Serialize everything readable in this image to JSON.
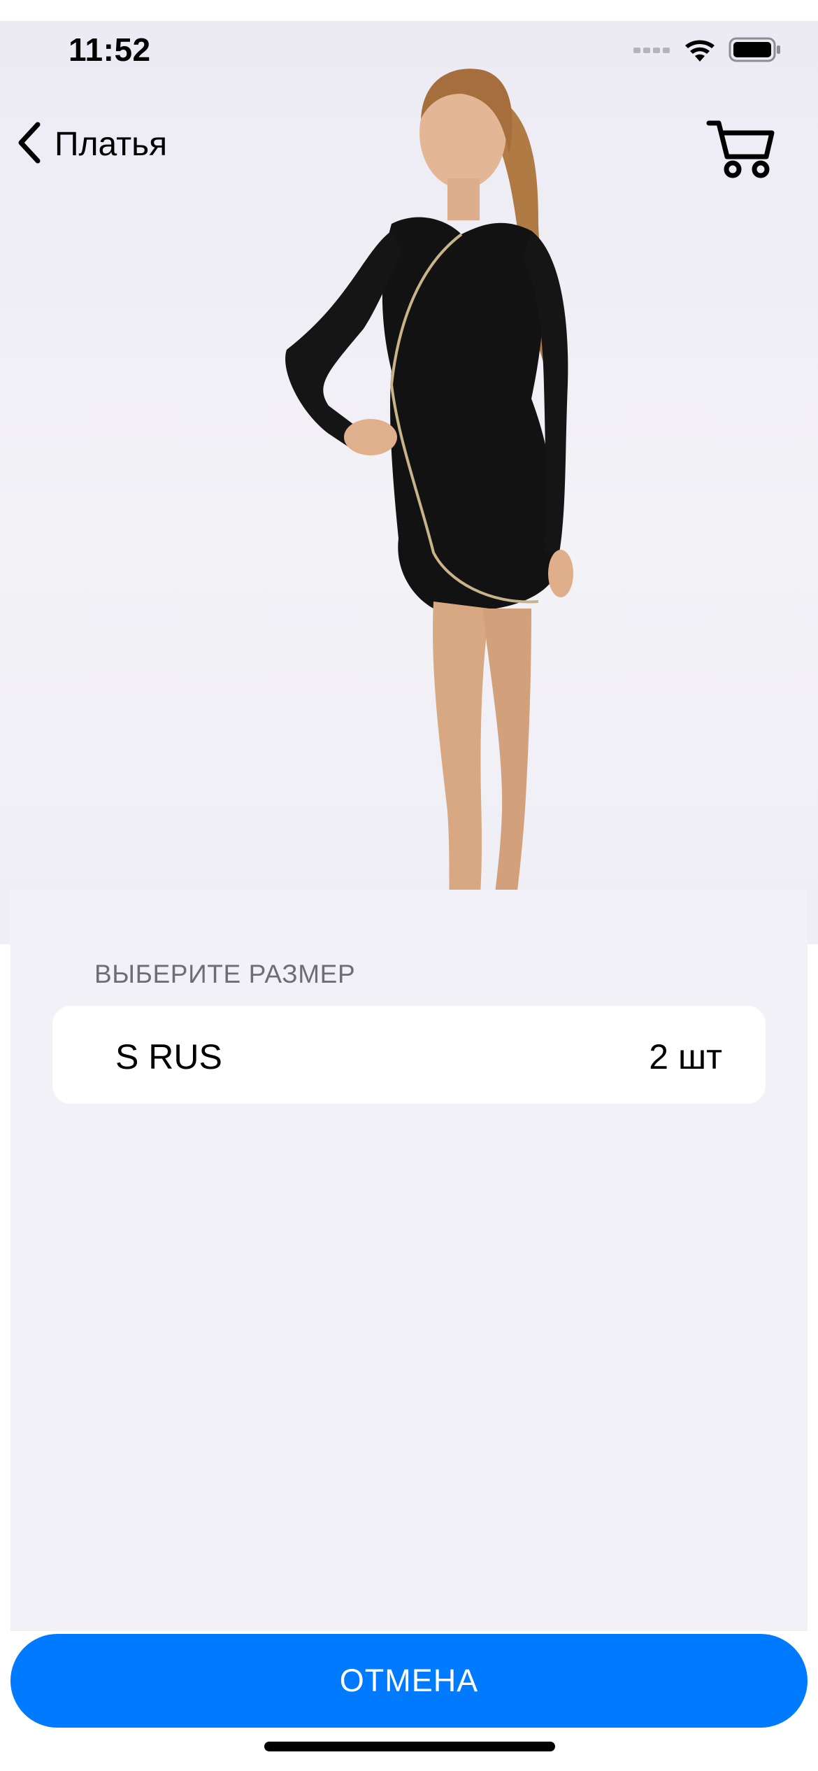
{
  "status_bar": {
    "time": "11:52"
  },
  "nav": {
    "back_label": "Платья"
  },
  "sheet": {
    "section_header": "ВЫБЕРИТЕ РАЗМЕР",
    "sizes": [
      {
        "name": "S RUS",
        "quantity": "2 шт"
      }
    ]
  },
  "actions": {
    "cancel_label": "ОТМЕНА"
  },
  "colors": {
    "accent": "#007aff",
    "sheet_background": "#f2f1f7",
    "row_background": "#ffffff",
    "section_header_text": "#6e6d74"
  },
  "icons": {
    "back": "chevron-left-icon",
    "cart": "cart-icon",
    "signal": "cellular-signal-icon",
    "wifi": "wifi-icon",
    "battery": "battery-icon"
  }
}
